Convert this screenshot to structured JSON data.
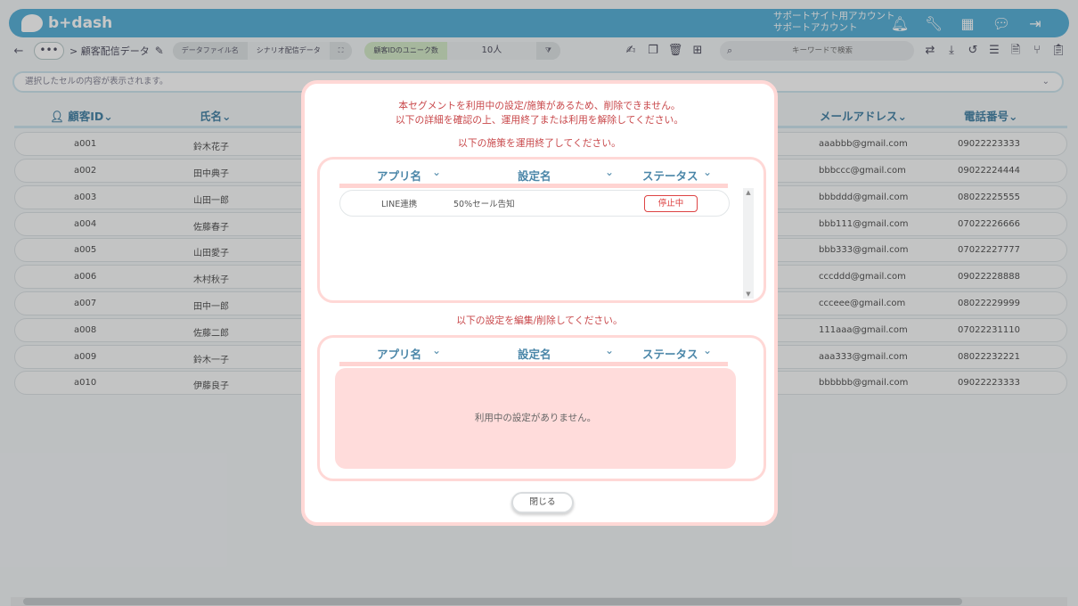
{
  "header": {
    "brand": "b+dash",
    "account_line1": "サポートサイト用アカウント",
    "account_line2": "サポートアカウント",
    "icons": [
      "bell-icon",
      "wrench-icon",
      "grid-icon",
      "chat-icon",
      "logout-icon"
    ]
  },
  "toolbar": {
    "back": "←",
    "more": "•••",
    "breadcrumb": "> 顧客配信データ",
    "data_file_label": "データファイル名",
    "data_file_value": "シナリオ配信データ",
    "unique_count_label": "顧客IDのユニーク数",
    "unique_count_value": "10人",
    "search_placeholder": "キーワードで検索"
  },
  "cellbar": {
    "text": "選択したセルの内容が表示されます。"
  },
  "table": {
    "headers": {
      "id": "顧客ID",
      "name": "氏名",
      "email": "メールアドレス",
      "phone": "電話番号"
    },
    "rows": [
      {
        "id": "a001",
        "name": "鈴木花子",
        "email": "aaabbb@gmail.com",
        "phone": "09022223333"
      },
      {
        "id": "a002",
        "name": "田中典子",
        "email": "bbbccc@gmail.com",
        "phone": "09022224444"
      },
      {
        "id": "a003",
        "name": "山田一郎",
        "email": "bbbddd@gmail.com",
        "phone": "08022225555"
      },
      {
        "id": "a004",
        "name": "佐藤春子",
        "email": "bbb111@gmail.com",
        "phone": "07022226666"
      },
      {
        "id": "a005",
        "name": "山田愛子",
        "email": "bbb333@gmail.com",
        "phone": "07022227777"
      },
      {
        "id": "a006",
        "name": "木村秋子",
        "email": "cccddd@gmail.com",
        "phone": "09022228888"
      },
      {
        "id": "a007",
        "name": "田中一郎",
        "email": "ccceee@gmail.com",
        "phone": "08022229999"
      },
      {
        "id": "a008",
        "name": "佐藤二郎",
        "email": "111aaa@gmail.com",
        "phone": "07022231110"
      },
      {
        "id": "a009",
        "name": "鈴木一子",
        "email": "aaa333@gmail.com",
        "phone": "08022232221"
      },
      {
        "id": "a010",
        "name": "伊藤良子",
        "email": "bbbbbb@gmail.com",
        "phone": "09022223333"
      }
    ]
  },
  "modal": {
    "message_line1": "本セグメントを利用中の設定/施策があるため、削除できません。",
    "message_line2": "以下の詳細を確認の上、運用終了または利用を解除してください。",
    "campaigns_heading": "以下の施策を運用終了してください。",
    "settings_heading": "以下の設定を編集/削除してください。",
    "columns": {
      "app": "アプリ名",
      "setting": "設定名",
      "status": "ステータス"
    },
    "campaign_row": {
      "app": "LINE連携",
      "setting": "50%セール告知",
      "status": "停止中"
    },
    "settings_empty": "利用中の設定がありません。",
    "close_label": "閉じる"
  },
  "colors": {
    "header_blue": "#5bb3d9",
    "alert_red": "#c8474a",
    "modal_border": "#ffd8d6"
  }
}
